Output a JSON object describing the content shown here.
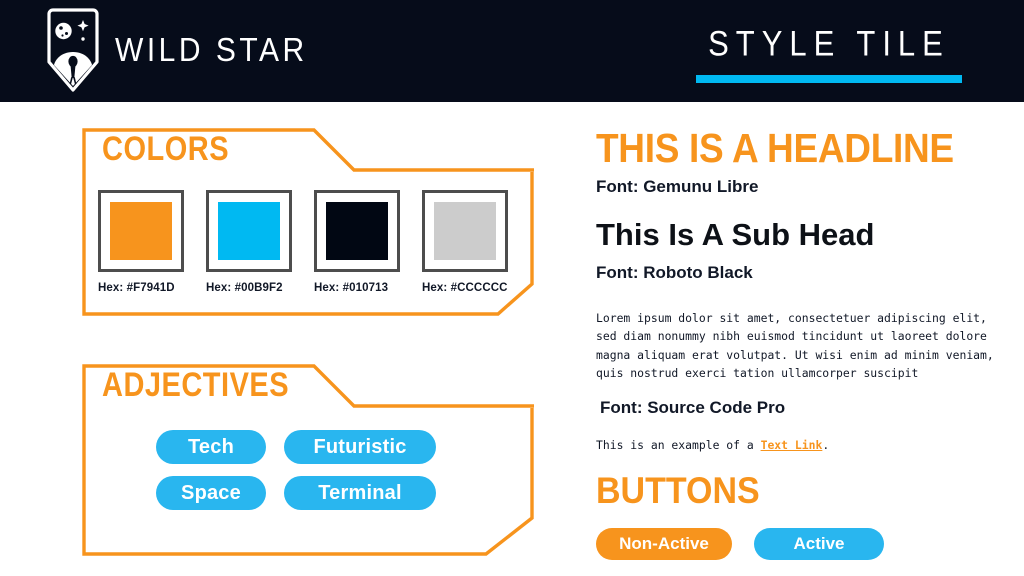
{
  "header": {
    "brand_name": "WILD STAR",
    "logo_icon": "shield-planet-astronaut-icon",
    "doc_title": "STYLE TILE",
    "accent_bar_color": "#00B9F2",
    "background_color": "#060C1A"
  },
  "colors_panel": {
    "title": "COLORS",
    "swatches": [
      {
        "hex_label": "Hex: #F7941D",
        "color": "#F7941D"
      },
      {
        "hex_label": "Hex: #00B9F2",
        "color": "#00B9F2"
      },
      {
        "hex_label": "Hex: #010713",
        "color": "#010713"
      },
      {
        "hex_label": "Hex: #CCCCCC",
        "color": "#CCCCCC"
      }
    ]
  },
  "adjectives_panel": {
    "title": "ADJECTIVES",
    "pills": [
      "Tech",
      "Futuristic",
      "Space",
      "Terminal"
    ],
    "pill_color": "#29B6EF"
  },
  "typography": {
    "headline": "THIS IS A HEADLINE",
    "headline_font_note": "Font: Gemunu Libre",
    "subhead": "This Is A Sub Head",
    "subhead_font_note": "Font: Roboto Black",
    "body_copy": "Lorem ipsum dolor sit amet, consectetuer adipiscing elit, sed diam nonummy nibh euismod tincidunt ut laoreet dolore magna aliquam erat volutpat. Ut wisi enim ad minim veniam, quis nostrud exerci tation ullamcorper suscipit",
    "body_font_note": "Font: Source Code Pro",
    "link_prefix": "This is an example of a ",
    "link_text": "Text Link",
    "link_suffix": ".",
    "headline_color": "#F7941D"
  },
  "buttons_section": {
    "title": "BUTTONS",
    "non_active_label": "Non-Active",
    "active_label": "Active",
    "non_active_color": "#F7941D",
    "active_color": "#29B6EF"
  }
}
